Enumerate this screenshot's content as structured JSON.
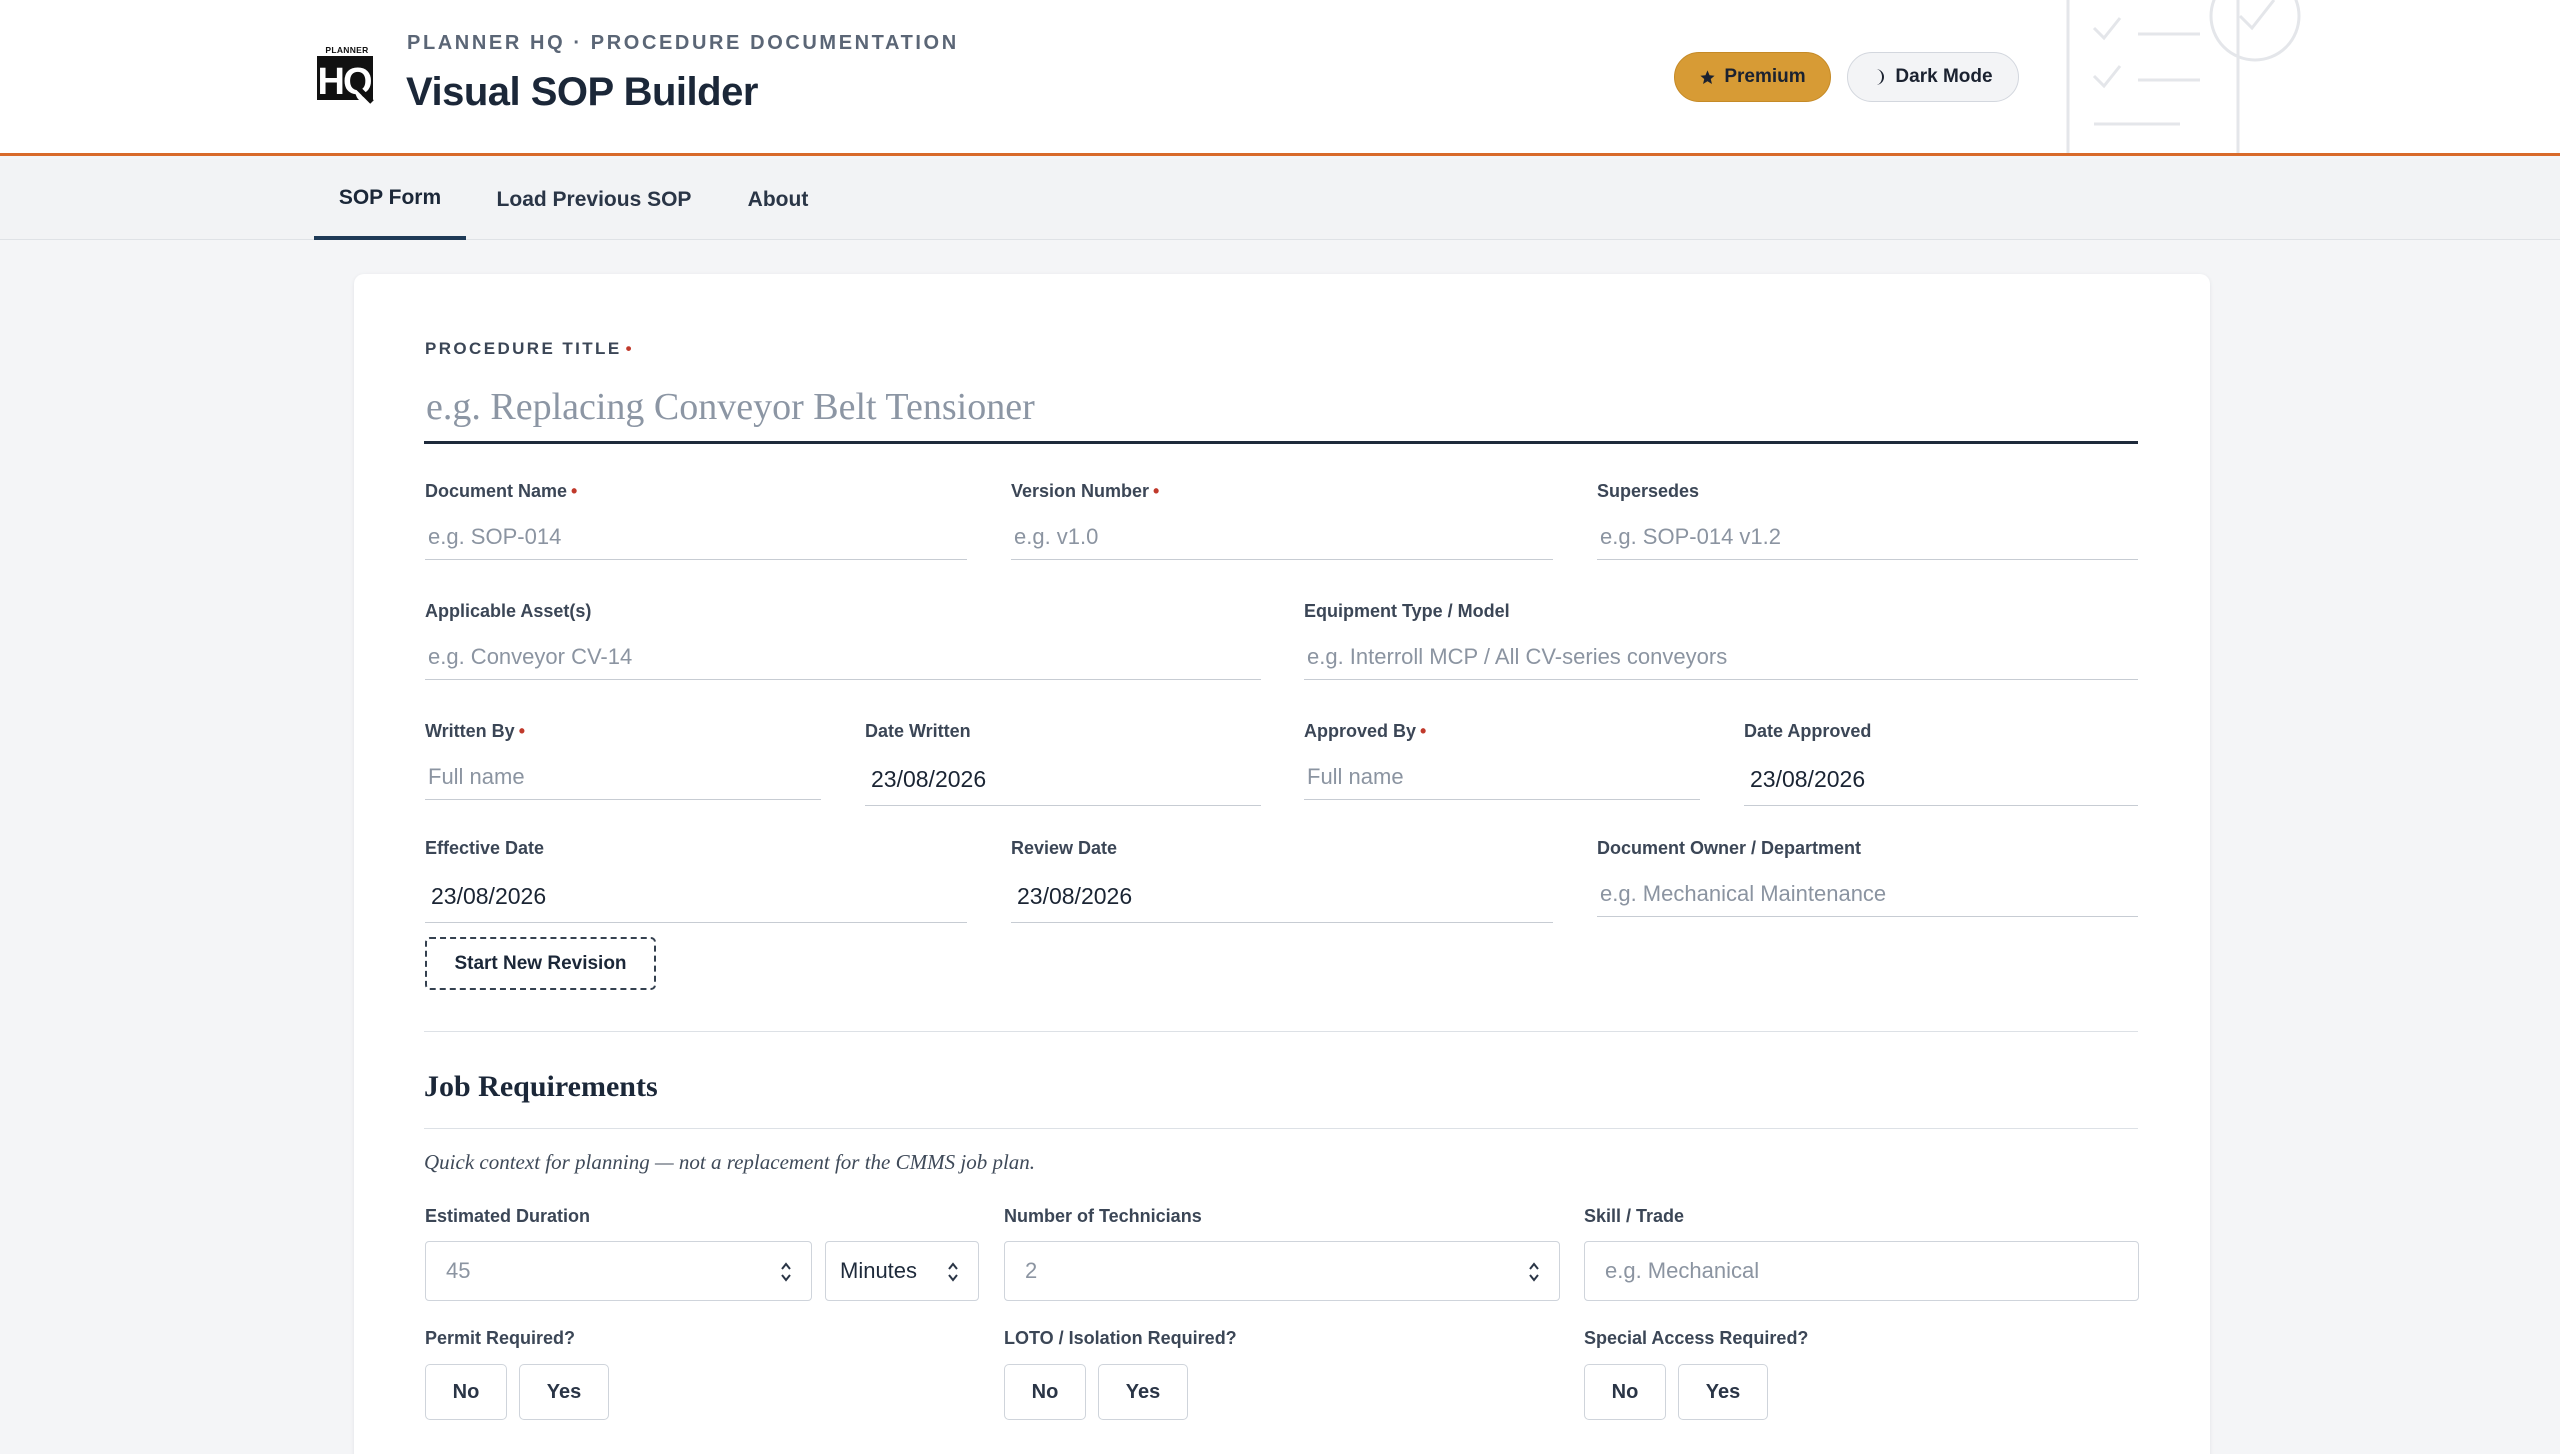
{
  "header": {
    "eyebrow": "PLANNER HQ · PROCEDURE DOCUMENTATION",
    "title": "Visual SOP Builder",
    "premium_label": "Premium",
    "dark_mode_label": "Dark Mode",
    "logo_top": "PLANNER",
    "logo_main": "HQ"
  },
  "tabs": [
    {
      "label": "SOP Form",
      "active": true
    },
    {
      "label": "Load Previous SOP",
      "active": false
    },
    {
      "label": "About",
      "active": false
    }
  ],
  "form": {
    "procedure_title": {
      "label": "PROCEDURE TITLE",
      "placeholder": "e.g. Replacing Conveyor Belt Tensioner",
      "required": true
    },
    "document_name": {
      "label": "Document Name",
      "placeholder": "e.g. SOP-014",
      "required": true
    },
    "version_number": {
      "label": "Version Number",
      "placeholder": "e.g. v1.0",
      "required": true
    },
    "supersedes": {
      "label": "Supersedes",
      "placeholder": "e.g. SOP-014 v1.2"
    },
    "applicable_assets": {
      "label": "Applicable Asset(s)",
      "placeholder": "e.g. Conveyor CV-14"
    },
    "equipment_type": {
      "label": "Equipment Type / Model",
      "placeholder": "e.g. Interroll MCP / All CV-series conveyors"
    },
    "written_by": {
      "label": "Written By",
      "placeholder": "Full name",
      "required": true
    },
    "date_written": {
      "label": "Date Written",
      "value": "23/08/2026"
    },
    "approved_by": {
      "label": "Approved By",
      "placeholder": "Full name",
      "required": true
    },
    "date_approved": {
      "label": "Date Approved",
      "value": "23/08/2026"
    },
    "effective_date": {
      "label": "Effective Date",
      "value": "23/08/2026"
    },
    "review_date": {
      "label": "Review Date",
      "value": "23/08/2026"
    },
    "document_owner": {
      "label": "Document Owner / Department",
      "placeholder": "e.g. Mechanical Maintenance"
    },
    "revision_button": "Start New Revision"
  },
  "job_requirements": {
    "title": "Job Requirements",
    "note": "Quick context for planning — not a replacement for the CMMS job plan.",
    "estimated_duration": {
      "label": "Estimated Duration",
      "placeholder": "45",
      "unit": "Minutes"
    },
    "technicians": {
      "label": "Number of Technicians",
      "placeholder": "2"
    },
    "skill": {
      "label": "Skill / Trade",
      "placeholder": "e.g. Mechanical"
    },
    "permit": {
      "label": "Permit Required?",
      "no": "No",
      "yes": "Yes"
    },
    "loto": {
      "label": "LOTO / Isolation Required?",
      "no": "No",
      "yes": "Yes"
    },
    "special_access": {
      "label": "Special Access Required?",
      "no": "No",
      "yes": "Yes"
    }
  },
  "colors": {
    "accent": "#d86a2a",
    "premium": "#d79b35",
    "navy": "#1f3a57",
    "required": "#c0392b"
  },
  "icons": {
    "premium": "star-icon",
    "dark_mode": "moon-icon",
    "spinner": "spinner-arrows-icon"
  }
}
